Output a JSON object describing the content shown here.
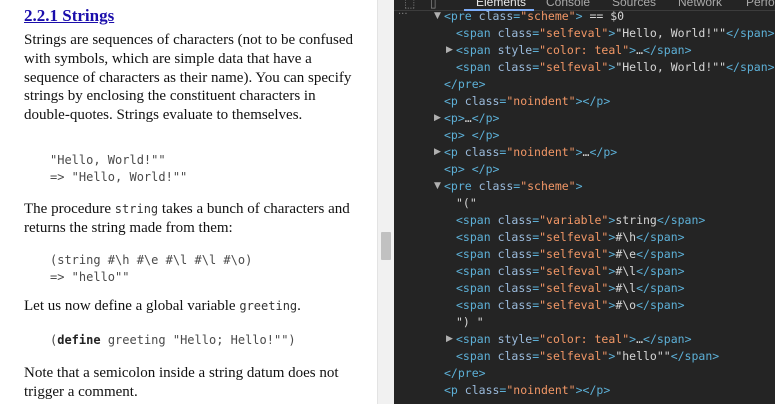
{
  "doc": {
    "title": "2.2.1  Strings",
    "p1": "Strings are sequences of characters (not to be confused with symbols, which are simple data that have a sequence of characters as their name). You can specify strings by enclosing the constituent characters in double-quotes. Strings evaluate to themselves.",
    "code1": "\"Hello, World!\"\"\n=> \"Hello, World!\"\"",
    "p2_before": "The procedure ",
    "p2_code": "string",
    "p2_after": " takes a bunch of characters and returns the string made from them:",
    "code2": "(string #\\h #\\e #\\l #\\l #\\o)\n=> \"hello\"\"",
    "p3_before": "Let us now define a global variable ",
    "p3_code": "greeting",
    "p3_after": ".",
    "code3_kw": "define",
    "code3_rest": " greeting \"Hello; Hello!\"\")",
    "p4": "Note that a semicolon inside a string datum does not trigger a comment."
  },
  "devtools": {
    "tabs": [
      "Elements",
      "Console",
      "Sources",
      "Network",
      "Perfo"
    ],
    "active_tab": "Elements",
    "lines": [
      "<pre class=\"scheme\"> == $0",
      "<span class=\"selfeval\">\"Hello, World!\"\"</span>",
      "<span style=\"color: teal\">…</span>",
      "<span class=\"selfeval\">\"Hello, World!\"\"</span>",
      "</pre>",
      "<p class=\"noindent\"></p>",
      "<p>…</p>",
      "<p> </p>",
      "<p class=\"noindent\">…</p>",
      "<p> </p>",
      "<pre class=\"scheme\">",
      "\"(\"",
      "<span class=\"variable\">string</span>",
      "<span class=\"selfeval\">#\\h</span>",
      "<span class=\"selfeval\">#\\e</span>",
      "<span class=\"selfeval\">#\\l</span>",
      "<span class=\"selfeval\">#\\l</span>",
      "<span class=\"selfeval\">#\\o</span>",
      "\") \"",
      "<span style=\"color: teal\">…</span>",
      "<span class=\"selfeval\">\"hello\"\"</span>",
      "</pre>",
      "<p class=\"noindent\"></p>"
    ]
  }
}
